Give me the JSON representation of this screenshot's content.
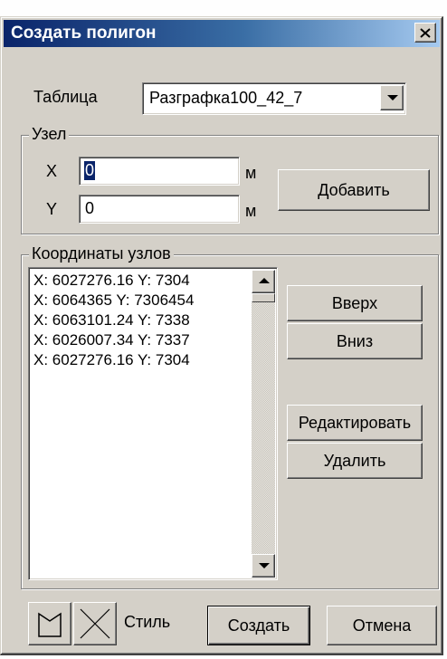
{
  "window": {
    "title": "Создать полигон"
  },
  "table": {
    "label": "Таблица",
    "selected": "Разграфка100_42_7"
  },
  "node": {
    "group_title": "Узел",
    "x_label": "X",
    "x_value": "0",
    "y_label": "Y",
    "y_value": "0",
    "x_unit": "м",
    "y_unit": "м",
    "add_label": "Добавить"
  },
  "coords": {
    "group_title": "Координаты узлов",
    "items": [
      "X: 6027276.16   Y: 7304",
      "X: 6064365   Y: 7306454",
      "X: 6063101.24   Y: 7338",
      "X: 6026007.34   Y: 7337",
      "X: 6027276.16   Y: 7304"
    ],
    "up_label": "Вверх",
    "down_label": "Вниз",
    "edit_label": "Редактировать",
    "delete_label": "Удалить"
  },
  "footer": {
    "style_label": "Стиль",
    "create_label": "Создать",
    "cancel_label": "Отмена"
  },
  "icons": {
    "close": "close-icon",
    "combo_arrow": "chevron-down-icon",
    "polygon_style": "polygon-icon",
    "cross_style": "cross-icon"
  },
  "colors": {
    "titlebar_start": "#0a246a",
    "titlebar_end": "#a6caf0",
    "face": "#d4d0c8",
    "selection": "#0a246a"
  }
}
